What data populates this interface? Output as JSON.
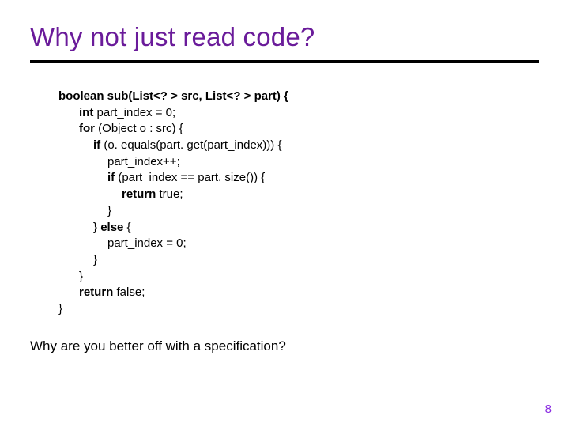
{
  "title": "Why not just read code?",
  "code": {
    "sig_kw": "boolean",
    "sig_rest": " sub(List<? > src, List<? > part) {",
    "l2_kw": "int",
    "l2_rest": " part_index = 0;",
    "l3_kw": "for",
    "l3_rest": " (Object o : src) {",
    "l4_kw": "if",
    "l4_rest": " (o. equals(part. get(part_index))) {",
    "l5": "part_index++;",
    "l6_kw": "if",
    "l6_rest": " (part_index == part. size()) {",
    "l7_kw": "return",
    "l7_rest": " true;",
    "l8": "}",
    "l9_a": "} ",
    "l9_kw": "else",
    "l9_b": " {",
    "l10": "part_index = 0;",
    "l11": "}",
    "l12": "}",
    "l13_kw": "return",
    "l13_rest": " false;",
    "l14": "}"
  },
  "question": "Why are you better off with a specification?",
  "page_number": "8"
}
